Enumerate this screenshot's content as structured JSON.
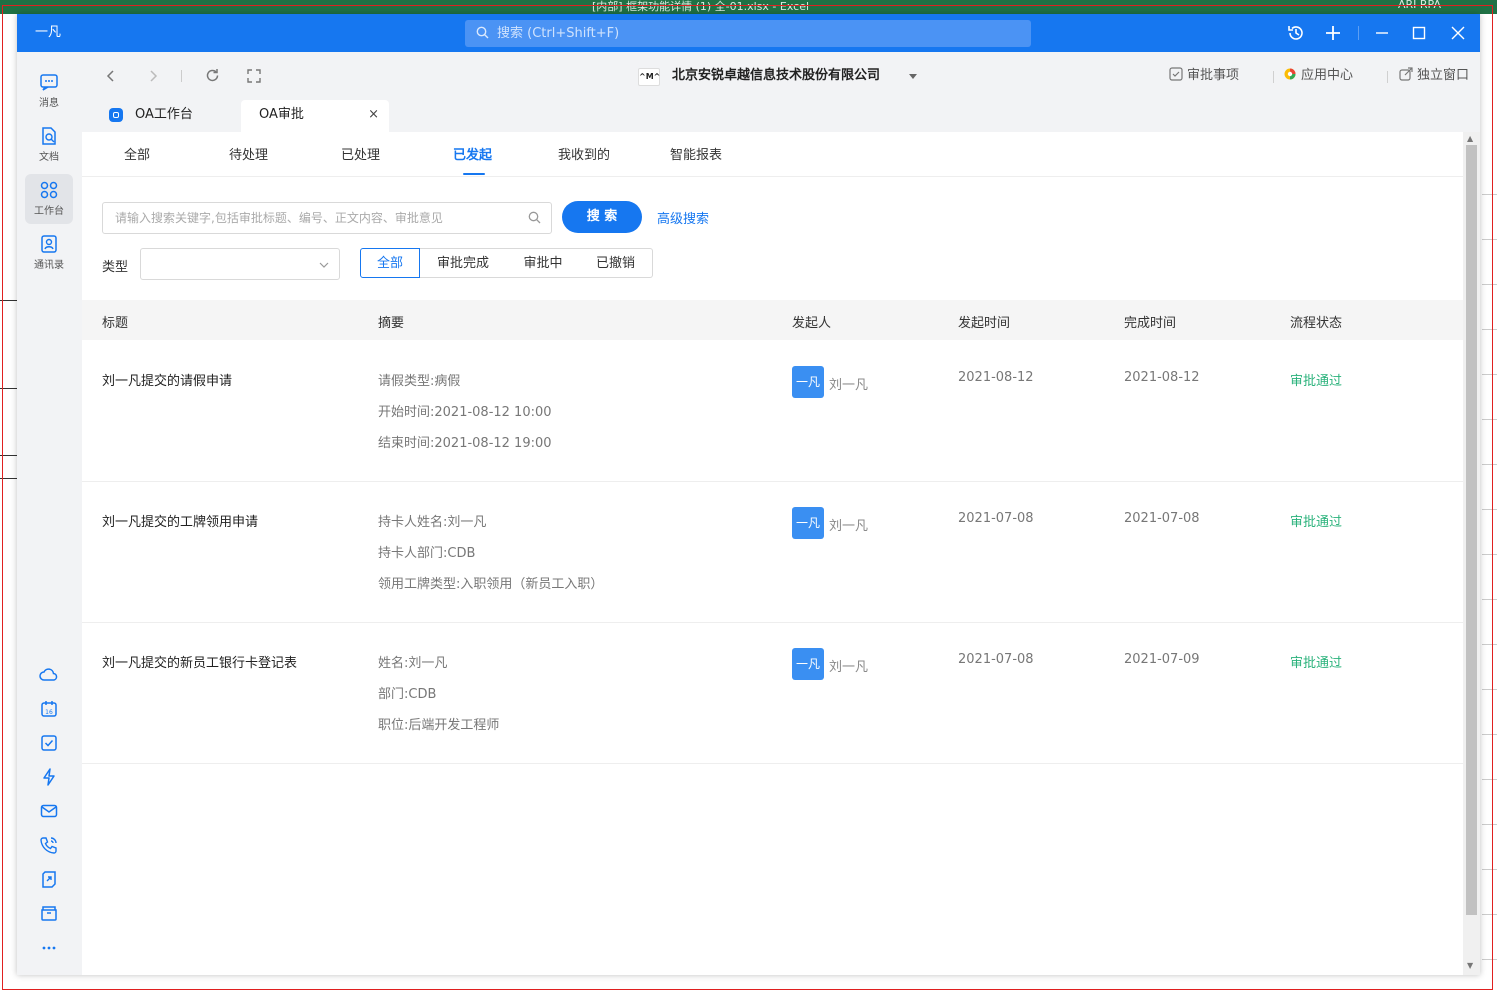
{
  "background": {
    "title_fragment": "[内部] 框架功能详情 (1) 全-01.xlsx - Excel",
    "top_right_fragment": "ARI RPA"
  },
  "app": {
    "logo_text": "一凡",
    "search_placeholder": "搜索 (Ctrl+Shift+F)"
  },
  "rail": {
    "items": [
      {
        "label": "消息",
        "icon": "message-icon"
      },
      {
        "label": "文档",
        "icon": "document-icon"
      },
      {
        "label": "工作台",
        "icon": "workbench-icon"
      },
      {
        "label": "通讯录",
        "icon": "contacts-icon"
      }
    ]
  },
  "header": {
    "company_logo_text": "^M^",
    "company_name": "北京安锐卓越信息技术股份有限公司",
    "links": [
      {
        "label": "审批事项",
        "icon": "checkbox-icon"
      },
      {
        "label": "应用中心",
        "icon": "app-center-icon"
      },
      {
        "label": "独立窗口",
        "icon": "new-window-icon"
      }
    ]
  },
  "tabs": [
    {
      "label": "OA工作台"
    },
    {
      "label": "OA审批",
      "close": "×"
    }
  ],
  "subtabs": [
    "全部",
    "待处理",
    "已处理",
    "已发起",
    "我收到的",
    "智能报表"
  ],
  "active_subtab": "已发起",
  "search": {
    "placeholder": "请输入搜索关键字,包括审批标题、编号、正文内容、审批意见",
    "button": "搜 索",
    "advanced": "高级搜索"
  },
  "filter": {
    "type_label": "类型",
    "type_value": "",
    "segments": [
      "全部",
      "审批完成",
      "审批中",
      "已撤销"
    ],
    "active_segment": "全部"
  },
  "table": {
    "columns": [
      "标题",
      "摘要",
      "发起人",
      "发起时间",
      "完成时间",
      "流程状态"
    ],
    "rows": [
      {
        "title": "刘一凡提交的请假申请",
        "summary": [
          "请假类型:病假",
          "开始时间:2021-08-12 10:00",
          "结束时间:2021-08-12 19:00"
        ],
        "avatar": "一凡",
        "initiator": "刘一凡",
        "start": "2021-08-12",
        "end": "2021-08-12",
        "status": "审批通过"
      },
      {
        "title": "刘一凡提交的工牌领用申请",
        "summary": [
          "持卡人姓名:刘一凡",
          "持卡人部门:CDB",
          "领用工牌类型:入职领用（新员工入职）"
        ],
        "avatar": "一凡",
        "initiator": "刘一凡",
        "start": "2021-07-08",
        "end": "2021-07-08",
        "status": "审批通过"
      },
      {
        "title": "刘一凡提交的新员工银行卡登记表",
        "summary": [
          "姓名:刘一凡",
          "部门:CDB",
          "职位:后端开发工程师"
        ],
        "avatar": "一凡",
        "initiator": "刘一凡",
        "start": "2021-07-08",
        "end": "2021-07-09",
        "status": "审批通过"
      }
    ]
  },
  "colors": {
    "accent": "#1677f0",
    "status_ok": "#2ab27b"
  }
}
